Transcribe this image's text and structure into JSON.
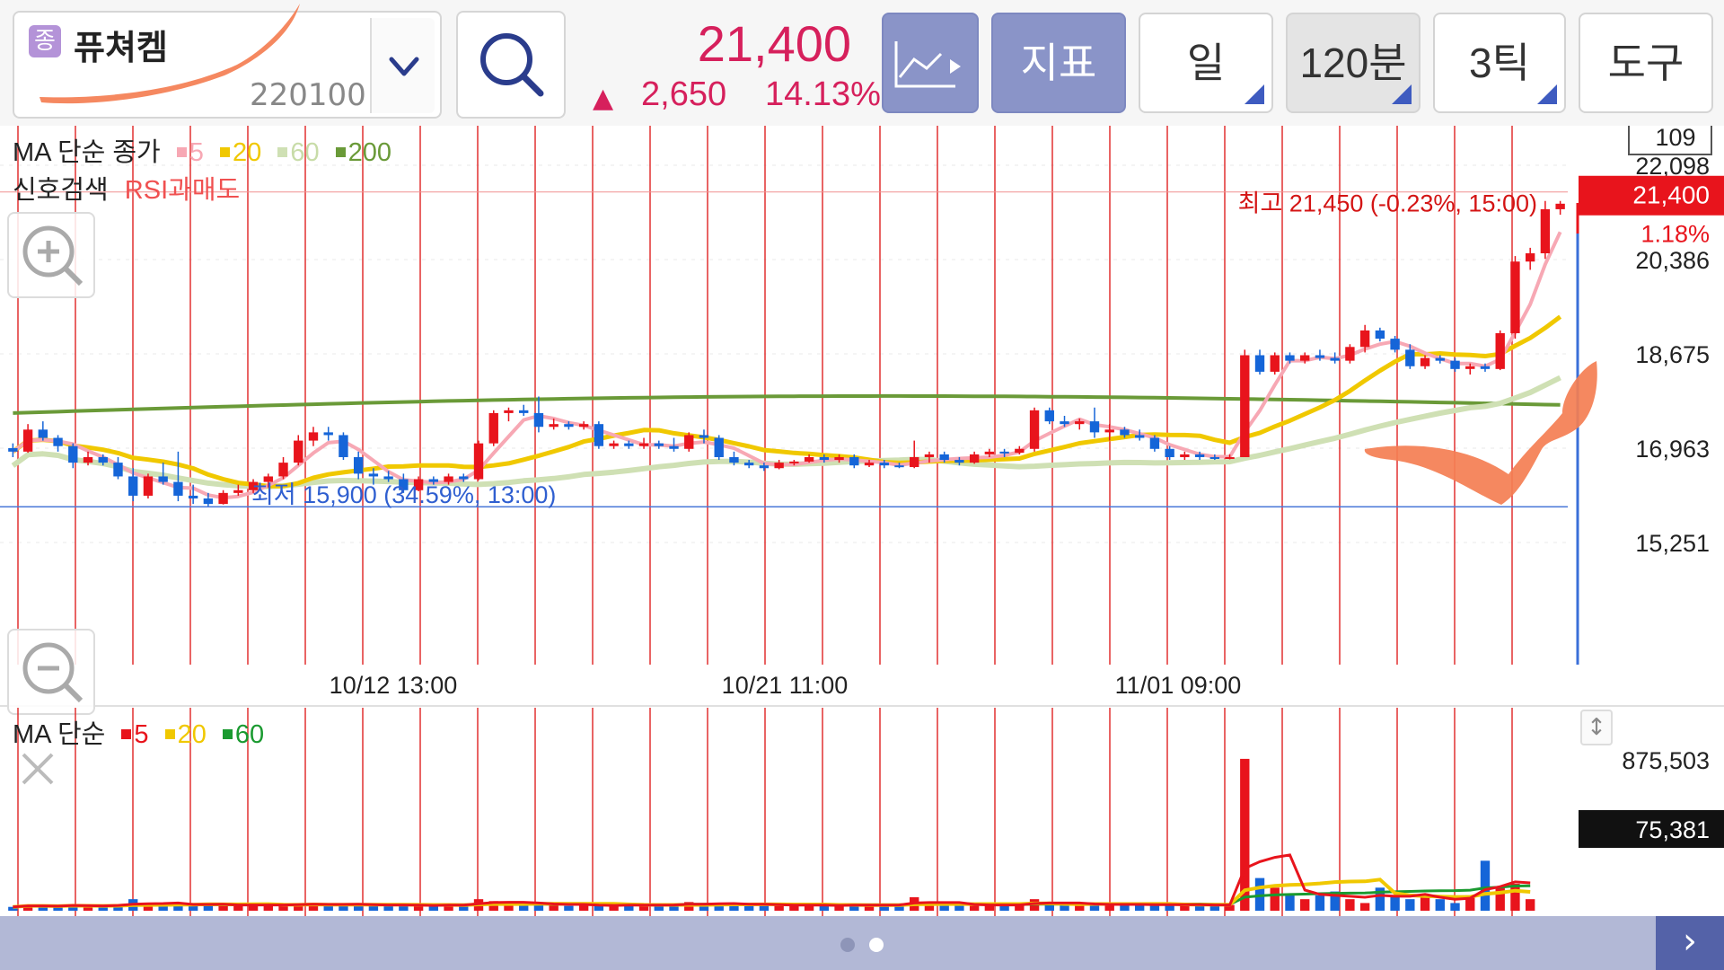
{
  "header": {
    "badge": "종",
    "stock_name": "퓨쳐켐",
    "stock_code": "220100",
    "price": "21,400",
    "change_arrow": "▲",
    "change_value": "2,650",
    "change_pct": "14.13%",
    "buttons": {
      "indicator": "지표",
      "period_day": "일",
      "period_minute": "120분",
      "tick": "3틱",
      "tools": "도구"
    }
  },
  "main_legend": {
    "title": "MA 단순 종가",
    "ma_labels": [
      "5",
      "20",
      "60",
      "200"
    ],
    "ma_colors": [
      "#f7a8b4",
      "#f0c800",
      "#cfe0b4",
      "#6a9a38"
    ],
    "signal_label": "신호검색",
    "signal_value": "RSI과매도"
  },
  "price_axis": {
    "ticks": [
      "22,098",
      "20,386",
      "18,675",
      "16,963",
      "15,251"
    ],
    "count_box": "109",
    "current_price_tag": "21,400",
    "current_pct_tag": "1.18%"
  },
  "annotations": {
    "high": "최고 21,450 (-0.23%, 15:00)",
    "low": "최저 15,900 (34.59%, 13:00)"
  },
  "time_axis": [
    "10/12 13:00",
    "10/21 11:00",
    "11/01 09:00"
  ],
  "volume_legend": {
    "title": "MA 단순",
    "ma_labels": [
      "5",
      "20",
      "60"
    ],
    "ma_colors": [
      "#e8141c",
      "#f0c800",
      "#1a9a30"
    ]
  },
  "volume_axis": {
    "max_label": "875,503",
    "current_tag": "75,381"
  },
  "colors": {
    "up": "#e8141c",
    "down": "#1565d8",
    "accent": "#d6205c",
    "divider_line": "#e23030"
  },
  "chart_data": {
    "type": "candlestick",
    "interval": "120분",
    "ylim": [
      15251,
      22098
    ],
    "high": 21450,
    "low": 15900,
    "last": 21400,
    "candles": [
      [
        16963,
        17050,
        16800,
        16900
      ],
      [
        16900,
        17400,
        16880,
        17300
      ],
      [
        17300,
        17450,
        17100,
        17150
      ],
      [
        17150,
        17200,
        16900,
        17000
      ],
      [
        17000,
        17050,
        16600,
        16700
      ],
      [
        16700,
        16900,
        16650,
        16800
      ],
      [
        16800,
        16850,
        16650,
        16700
      ],
      [
        16700,
        16800,
        16400,
        16450
      ],
      [
        16450,
        16600,
        16000,
        16100
      ],
      [
        16100,
        16500,
        16050,
        16450
      ],
      [
        16450,
        16700,
        16300,
        16350
      ],
      [
        16350,
        16900,
        16000,
        16100
      ],
      [
        16100,
        16300,
        15950,
        16050
      ],
      [
        16050,
        16150,
        15900,
        15950
      ],
      [
        15950,
        16200,
        15940,
        16150
      ],
      [
        16150,
        16300,
        16100,
        16200
      ],
      [
        16200,
        16400,
        16150,
        16350
      ],
      [
        16350,
        16500,
        16250,
        16450
      ],
      [
        16450,
        16800,
        16400,
        16700
      ],
      [
        16700,
        17200,
        16650,
        17100
      ],
      [
        17100,
        17350,
        17000,
        17250
      ],
      [
        17250,
        17350,
        17100,
        17200
      ],
      [
        17200,
        17250,
        16750,
        16800
      ],
      [
        16800,
        16900,
        16400,
        16500
      ],
      [
        16500,
        16600,
        16300,
        16450
      ],
      [
        16450,
        16550,
        16350,
        16400
      ],
      [
        16400,
        16500,
        16150,
        16200
      ],
      [
        16200,
        16450,
        16180,
        16400
      ],
      [
        16400,
        16450,
        16300,
        16350
      ],
      [
        16350,
        16500,
        16300,
        16450
      ],
      [
        16450,
        16500,
        16350,
        16400
      ],
      [
        16400,
        17100,
        16380,
        17050
      ],
      [
        17050,
        17650,
        17000,
        17600
      ],
      [
        17600,
        17700,
        17450,
        17650
      ],
      [
        17650,
        17750,
        17550,
        17600
      ],
      [
        17600,
        17900,
        17250,
        17350
      ],
      [
        17350,
        17500,
        17300,
        17400
      ],
      [
        17400,
        17450,
        17300,
        17350
      ],
      [
        17350,
        17450,
        17300,
        17400
      ],
      [
        17400,
        17450,
        16950,
        17000
      ],
      [
        17000,
        17100,
        16950,
        17050
      ],
      [
        17050,
        17100,
        16950,
        17000
      ],
      [
        17000,
        17150,
        16950,
        17050
      ],
      [
        17050,
        17100,
        16950,
        17000
      ],
      [
        17000,
        17150,
        16900,
        16950
      ],
      [
        16950,
        17250,
        16900,
        17200
      ],
      [
        17200,
        17300,
        17050,
        17150
      ],
      [
        17150,
        17200,
        16750,
        16800
      ],
      [
        16800,
        16900,
        16650,
        16700
      ],
      [
        16700,
        16750,
        16600,
        16650
      ],
      [
        16650,
        16700,
        16550,
        16600
      ],
      [
        16600,
        16750,
        16580,
        16700
      ],
      [
        16700,
        16750,
        16650,
        16720
      ],
      [
        16720,
        16850,
        16700,
        16800
      ],
      [
        16800,
        16850,
        16700,
        16750
      ],
      [
        16750,
        16850,
        16700,
        16800
      ],
      [
        16800,
        16850,
        16600,
        16650
      ],
      [
        16650,
        16750,
        16620,
        16700
      ],
      [
        16700,
        16750,
        16600,
        16650
      ],
      [
        16650,
        16700,
        16600,
        16620
      ],
      [
        16620,
        17100,
        16600,
        16800
      ],
      [
        16800,
        16900,
        16700,
        16850
      ],
      [
        16850,
        16900,
        16700,
        16750
      ],
      [
        16750,
        16800,
        16650,
        16700
      ],
      [
        16700,
        16900,
        16680,
        16850
      ],
      [
        16850,
        16950,
        16800,
        16900
      ],
      [
        16900,
        16950,
        16800,
        16880
      ],
      [
        16880,
        17000,
        16850,
        16950
      ],
      [
        16950,
        17700,
        16900,
        17650
      ],
      [
        17650,
        17700,
        17400,
        17450
      ],
      [
        17450,
        17550,
        17350,
        17400
      ],
      [
        17400,
        17500,
        17300,
        17450
      ],
      [
        17450,
        17700,
        17150,
        17250
      ],
      [
        17250,
        17400,
        17100,
        17300
      ],
      [
        17300,
        17350,
        17150,
        17200
      ],
      [
        17200,
        17300,
        17100,
        17150
      ],
      [
        17150,
        17200,
        16900,
        16950
      ],
      [
        16950,
        17000,
        16750,
        16800
      ],
      [
        16800,
        16900,
        16750,
        16850
      ],
      [
        16850,
        16900,
        16750,
        16800
      ],
      [
        16800,
        16850,
        16750,
        16780
      ],
      [
        16780,
        16850,
        16760,
        16800
      ],
      [
        16800,
        18750,
        16900,
        18650
      ],
      [
        18650,
        18750,
        18300,
        18350
      ],
      [
        18350,
        18700,
        18300,
        18650
      ],
      [
        18650,
        18700,
        18500,
        18550
      ],
      [
        18550,
        18700,
        18500,
        18650
      ],
      [
        18650,
        18750,
        18550,
        18600
      ],
      [
        18600,
        18700,
        18500,
        18550
      ],
      [
        18550,
        18850,
        18500,
        18800
      ],
      [
        18800,
        19200,
        18700,
        19100
      ],
      [
        19100,
        19150,
        18900,
        18950
      ],
      [
        18950,
        19000,
        18700,
        18750
      ],
      [
        18750,
        18850,
        18400,
        18450
      ],
      [
        18450,
        18650,
        18400,
        18600
      ],
      [
        18600,
        18650,
        18500,
        18550
      ],
      [
        18550,
        18600,
        18350,
        18400
      ],
      [
        18400,
        18500,
        18300,
        18450
      ],
      [
        18450,
        18500,
        18350,
        18400
      ],
      [
        18400,
        19100,
        18380,
        19050
      ],
      [
        19050,
        20450,
        18950,
        20350
      ],
      [
        20350,
        20600,
        20200,
        20500
      ],
      [
        20500,
        21450,
        20400,
        21300
      ],
      [
        21300,
        21450,
        21200,
        21400
      ]
    ],
    "volume": [
      20,
      30,
      25,
      20,
      35,
      25,
      20,
      30,
      60,
      35,
      25,
      40,
      30,
      35,
      30,
      25,
      30,
      35,
      30,
      30,
      40,
      30,
      30,
      35,
      30,
      25,
      30,
      30,
      25,
      30,
      30,
      60,
      50,
      35,
      30,
      45,
      30,
      25,
      30,
      30,
      25,
      30,
      30,
      30,
      30,
      45,
      30,
      40,
      35,
      30,
      30,
      30,
      25,
      30,
      30,
      25,
      30,
      30,
      30,
      30,
      70,
      40,
      30,
      30,
      30,
      30,
      30,
      30,
      60,
      40,
      30,
      30,
      40,
      30,
      30,
      30,
      35,
      30,
      30,
      30,
      30,
      30,
      790,
      170,
      120,
      80,
      60,
      80,
      100,
      60,
      40,
      120,
      80,
      60,
      80,
      60,
      40,
      80,
      260,
      120,
      140,
      60
    ],
    "volume_max": 875503,
    "volume_last": 75381,
    "time_labels": [
      "10/12 13:00",
      "10/21 11:00",
      "11/01 09:00"
    ]
  }
}
